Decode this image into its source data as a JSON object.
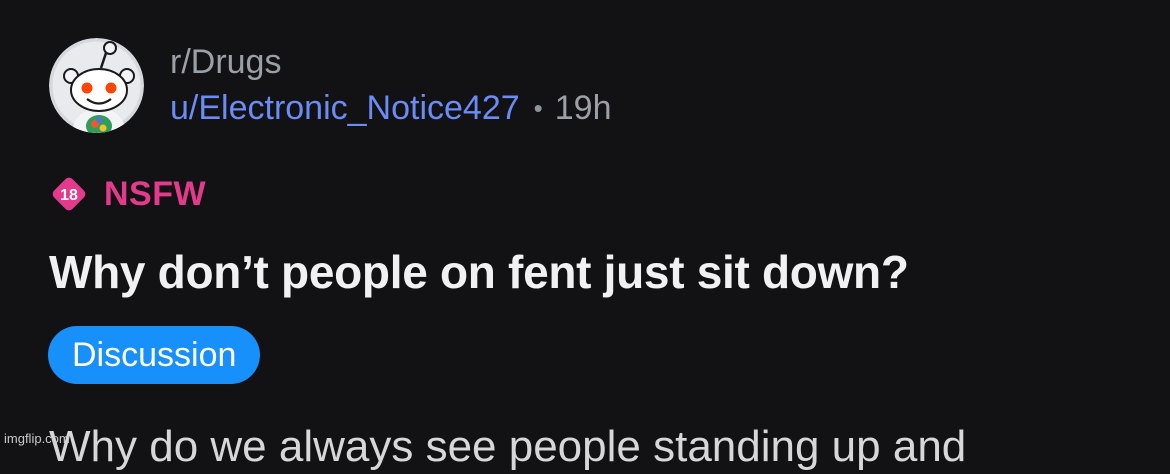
{
  "post": {
    "subreddit": "r/Drugs",
    "author": "u/Electronic_Notice427",
    "separator": "•",
    "age": "19h",
    "nsfw": {
      "icon_text": "18",
      "label": "NSFW",
      "color": "#e33a8c"
    },
    "title": "Why don’t people on fent just sit down?",
    "flair": {
      "label": "Discussion",
      "color": "#1890fb"
    },
    "body_preview": "Why do we always see people standing up and"
  },
  "watermark": "imgflip.com",
  "colors": {
    "background": "#121215",
    "username": "#6b8bf5",
    "muted_text": "#9aa0a6",
    "title_text": "#f1f1f3"
  },
  "icons": {
    "avatar": "snoo-avatar-icon",
    "nsfw": "nsfw-18-icon"
  }
}
